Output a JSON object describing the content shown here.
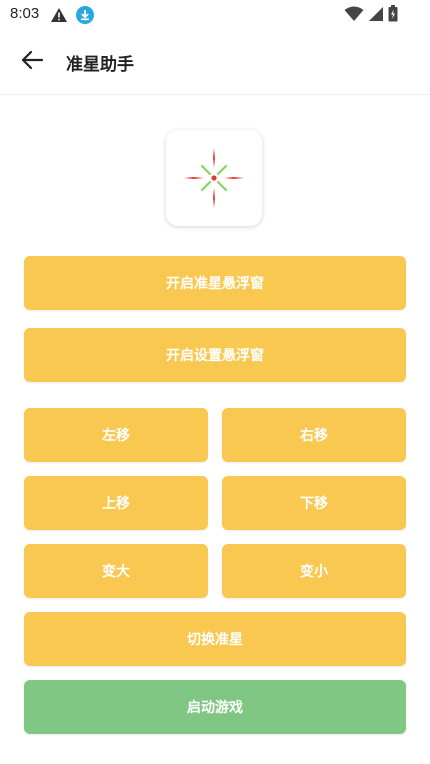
{
  "status_bar": {
    "time": "8:03",
    "left_icons": [
      "warning-icon",
      "download-icon"
    ],
    "right_icons": [
      "wifi-icon",
      "signal-icon",
      "battery-icon"
    ]
  },
  "app_bar": {
    "title": "准星助手",
    "back_icon": "arrow-left-icon"
  },
  "crosshair_preview": {
    "icon": "crosshair-icon",
    "colors": {
      "arms": "#e53935",
      "diagonals": "#7ed957",
      "center": "#e53935"
    }
  },
  "buttons": {
    "open_crosshair_overlay": "开启准星悬浮窗",
    "open_settings_overlay": "开启设置悬浮窗",
    "move_left": "左移",
    "move_right": "右移",
    "move_up": "上移",
    "move_down": "下移",
    "enlarge": "变大",
    "shrink": "变小",
    "switch_crosshair": "切换准星",
    "launch_game": "启动游戏"
  },
  "colors": {
    "primary_button": "#f9c851",
    "launch_button": "#81c784",
    "button_text": "#ffffff"
  }
}
